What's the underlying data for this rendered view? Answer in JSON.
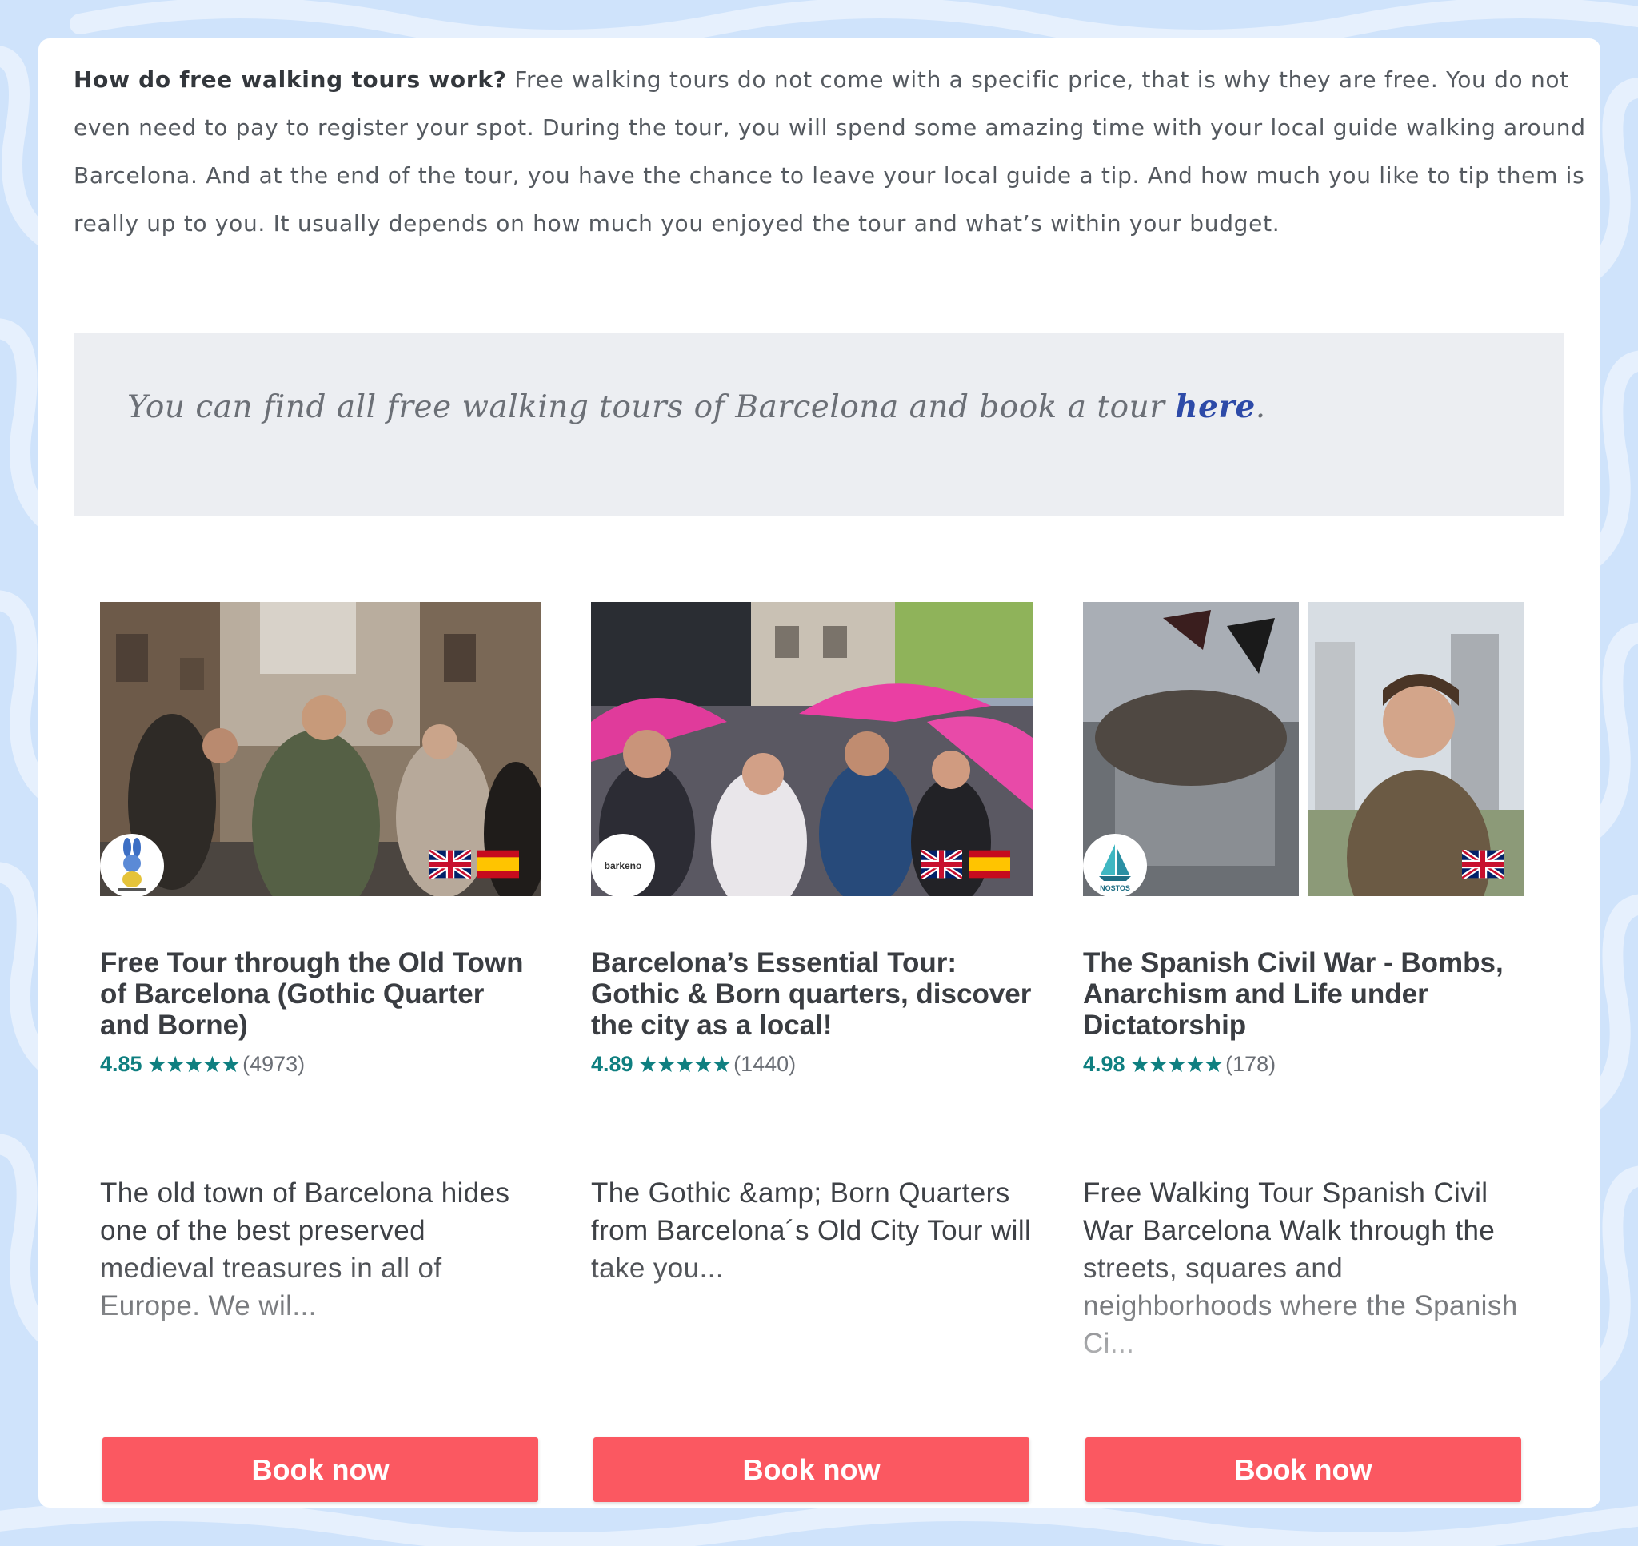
{
  "intro": {
    "bold": "How do free walking tours work?",
    "text": " Free walking tours do not come with a specific price, that is why they are free. You do not even need to pay to register your spot. During the tour, you will spend some amazing time with your local guide walking around Barcelona. And at the end of the tour, you have the chance to leave your local guide a tip. And how much you like to tip them is really up to you. It usually depends on how much you enjoyed the tour and what’s within your budget."
  },
  "callout": {
    "text": "You can find all free walking tours of Barcelona and book a tour ",
    "link": "here",
    "end": "."
  },
  "colors": {
    "page_bg": "#cfe3fb",
    "accent_button": "#fb5861",
    "rating_teal": "#0f7f80",
    "link_blue": "#2d4aa8"
  },
  "tours": [
    {
      "title": "Free Tour through the Old Town of Barcelona (Gothic Quarter and Borne)",
      "score": "4.85",
      "stars": "★★★★★",
      "count": "(4973)",
      "description": "The old town of Barcelona hides one of the best preserved medieval treasures in all of Europe. We wil...",
      "flags": [
        "uk-flag",
        "spain-flag"
      ],
      "button": "Book now"
    },
    {
      "title": "Barcelona’s Essential Tour: Gothic & Born quarters, discover the city as a local!",
      "score": "4.89",
      "stars": "★★★★★",
      "count": "(1440)",
      "description": "The Gothic &amp; Born Quarters from Barcelona´s Old City Tour will take you...",
      "logo_text": "barkeno",
      "flags": [
        "uk-flag",
        "spain-flag"
      ],
      "button": "Book now"
    },
    {
      "title": "The Spanish Civil War - Bombs, Anarchism and Life under Dictatorship",
      "score": "4.98",
      "stars": "★★★★★",
      "count": "(178)",
      "description": "Free Walking Tour Spanish Civil War Barcelona Walk through the streets, squares and neighborhoods where the Spanish Ci...",
      "logo_text": "NOSTOS",
      "flags": [
        "uk-flag"
      ],
      "button": "Book now"
    }
  ]
}
